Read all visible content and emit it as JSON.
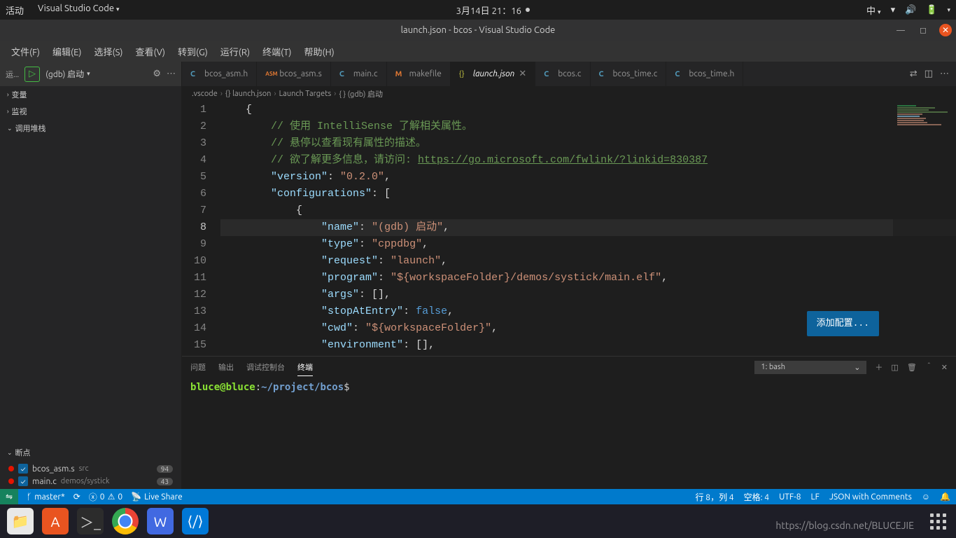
{
  "gnome": {
    "activities": "活动",
    "app_name": "Visual Studio Code",
    "datetime": "3月14日  21：16",
    "ime": "中"
  },
  "title_bar": "launch.json - bcos - Visual Studio Code",
  "menu": [
    "文件(F)",
    "编辑(E)",
    "选择(S)",
    "查看(V)",
    "转到(G)",
    "运行(R)",
    "终端(T)",
    "帮助(H)"
  ],
  "debug": {
    "run_label": "运...",
    "config": "(gdb) 启动",
    "sections": {
      "vars": "变量",
      "watch": "监视",
      "callstack": "调用堆栈",
      "breakpoints": "断点"
    },
    "breakpoints": [
      {
        "file": "bcos_asm.s",
        "path": "src",
        "count": "94"
      },
      {
        "file": "main.c",
        "path": "demos/systick",
        "count": "43"
      }
    ]
  },
  "tabs": [
    {
      "label": "bcos_asm.h",
      "icon": "c"
    },
    {
      "label": "bcos_asm.s",
      "icon": "asm"
    },
    {
      "label": "main.c",
      "icon": "c"
    },
    {
      "label": "makefile",
      "icon": "m"
    },
    {
      "label": "launch.json",
      "icon": "json",
      "active": true,
      "dirty": false
    },
    {
      "label": "bcos.c",
      "icon": "c"
    },
    {
      "label": "bcos_time.c",
      "icon": "c"
    },
    {
      "label": "bcos_time.h",
      "icon": "c"
    }
  ],
  "breadcrumbs": [
    ".vscode",
    "{} launch.json",
    "Launch Targets",
    "{ } (gdb) 启动"
  ],
  "code": {
    "lines": [
      {
        "n": 1,
        "indent": 1,
        "html": "<span class='tok-punc'>{</span>"
      },
      {
        "n": 2,
        "indent": 2,
        "html": "<span class='tok-comment'>// 使用 IntelliSense 了解相关属性。</span>"
      },
      {
        "n": 3,
        "indent": 2,
        "html": "<span class='tok-comment'>// 悬停以查看现有属性的描述。</span>"
      },
      {
        "n": 4,
        "indent": 2,
        "html": "<span class='tok-comment'>// 欲了解更多信息，请访问: </span><span class='tok-link'>https://go.microsoft.com/fwlink/?linkid=830387</span>"
      },
      {
        "n": 5,
        "indent": 2,
        "html": "<span class='tok-key'>\"version\"</span><span class='tok-punc'>: </span><span class='tok-string'>\"0.2.0\"</span><span class='tok-punc'>,</span>"
      },
      {
        "n": 6,
        "indent": 2,
        "html": "<span class='tok-key'>\"configurations\"</span><span class='tok-punc'>: [</span>"
      },
      {
        "n": 7,
        "indent": 3,
        "html": "<span class='tok-punc'>{</span>"
      },
      {
        "n": 8,
        "indent": 4,
        "html": "<span class='tok-key'>\"name\"</span><span class='tok-punc'>: </span><span class='tok-string'>\"(gdb) 启动\"</span><span class='tok-punc'>,</span>",
        "current": true
      },
      {
        "n": 9,
        "indent": 4,
        "html": "<span class='tok-key'>\"type\"</span><span class='tok-punc'>: </span><span class='tok-string'>\"cppdbg\"</span><span class='tok-punc'>,</span>"
      },
      {
        "n": 10,
        "indent": 4,
        "html": "<span class='tok-key'>\"request\"</span><span class='tok-punc'>: </span><span class='tok-string'>\"launch\"</span><span class='tok-punc'>,</span>"
      },
      {
        "n": 11,
        "indent": 4,
        "html": "<span class='tok-key'>\"program\"</span><span class='tok-punc'>: </span><span class='tok-string'>\"${workspaceFolder}/demos/systick/main.elf\"</span><span class='tok-punc'>,</span>"
      },
      {
        "n": 12,
        "indent": 4,
        "html": "<span class='tok-key'>\"args\"</span><span class='tok-punc'>: [],</span>"
      },
      {
        "n": 13,
        "indent": 4,
        "html": "<span class='tok-key'>\"stopAtEntry\"</span><span class='tok-punc'>: </span><span class='tok-bool'>false</span><span class='tok-punc'>,</span>"
      },
      {
        "n": 14,
        "indent": 4,
        "html": "<span class='tok-key'>\"cwd\"</span><span class='tok-punc'>: </span><span class='tok-string'>\"${workspaceFolder}\"</span><span class='tok-punc'>,</span>"
      },
      {
        "n": 15,
        "indent": 4,
        "html": "<span class='tok-key'>\"environment\"</span><span class='tok-punc'>: [],</span>"
      }
    ]
  },
  "add_config": "添加配置...",
  "panel": {
    "tabs": {
      "problems": "问题",
      "output": "输出",
      "debug_console": "调试控制台",
      "terminal": "终端"
    },
    "terminal_name": "1: bash",
    "prompt_user": "bluce@bluce",
    "prompt_colon": ":",
    "prompt_path": "~/project/bcos",
    "prompt_dollar": "$"
  },
  "status": {
    "branch": "master*",
    "sync": "",
    "errors": "0",
    "warnings": "0",
    "live_share": "Live Share",
    "line_col": "行 8，列 4",
    "spaces": "空格: 4",
    "encoding": "UTF-8",
    "eol": "LF",
    "lang": "JSON with Comments"
  },
  "watermark": "https://blog.csdn.net/BLUCEJIE"
}
